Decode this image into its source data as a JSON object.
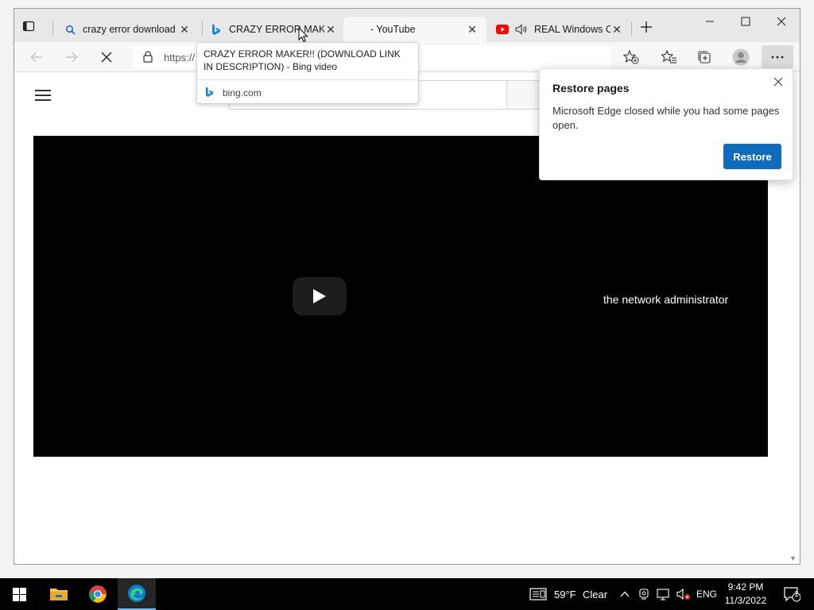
{
  "tabs": [
    {
      "title": "crazy error download",
      "icon": "search-icon"
    },
    {
      "title": "CRAZY ERROR MAKER!! (DOWNLOAD LINK IN DESCRIPTION)",
      "icon": "bing-icon"
    },
    {
      "title": "- YouTube",
      "icon": ""
    },
    {
      "title": "REAL Windows Crash",
      "icon": "youtube-icon",
      "audio": true
    }
  ],
  "toolbar": {
    "url": "https://"
  },
  "tooltip": {
    "title": "CRAZY ERROR MAKER!! (DOWNLOAD LINK IN DESCRIPTION) - Bing video",
    "site": "bing.com"
  },
  "page": {
    "player_message": "the network administrator"
  },
  "restore_popup": {
    "title": "Restore pages",
    "message": "Microsoft Edge closed while you had some pages open.",
    "button": "Restore"
  },
  "taskbar": {
    "weather_temp": "59°F",
    "weather_desc": "Clear",
    "language": "ENG",
    "time": "9:42 PM",
    "date": "11/3/2022",
    "notification_count": "1"
  },
  "colors": {
    "accent": "#0f6cbd",
    "youtube_red": "#ff0000",
    "bing_blue": "#1a8ad4"
  }
}
